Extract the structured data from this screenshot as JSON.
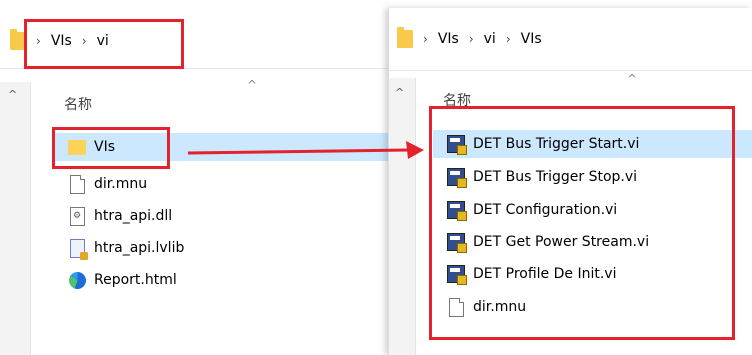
{
  "left_window": {
    "breadcrumb": [
      "VIs",
      "vi"
    ],
    "column_header": "名称",
    "items": [
      {
        "name": "VIs",
        "icon": "folder-icon"
      },
      {
        "name": "dir.mnu",
        "icon": "file-icon"
      },
      {
        "name": "htra_api.dll",
        "icon": "dll-file-icon"
      },
      {
        "name": "htra_api.lvlib",
        "icon": "labview-library-icon"
      },
      {
        "name": "Report.html",
        "icon": "edge-browser-icon"
      }
    ]
  },
  "right_window": {
    "breadcrumb": [
      "VIs",
      "vi",
      "VIs"
    ],
    "column_header": "名称",
    "items": [
      {
        "name": "DET Bus Trigger Start.vi",
        "icon": "labview-vi-icon"
      },
      {
        "name": "DET Bus Trigger Stop.vi",
        "icon": "labview-vi-icon"
      },
      {
        "name": "DET Configuration.vi",
        "icon": "labview-vi-icon"
      },
      {
        "name": "DET Get Power Stream.vi",
        "icon": "labview-vi-icon"
      },
      {
        "name": "DET Profile De Init.vi",
        "icon": "labview-vi-icon"
      },
      {
        "name": "dir.mnu",
        "icon": "file-icon"
      }
    ]
  },
  "colors": {
    "highlight_red": "#e3222b",
    "selection": "#cce8ff",
    "folder": "#fbd25a"
  }
}
